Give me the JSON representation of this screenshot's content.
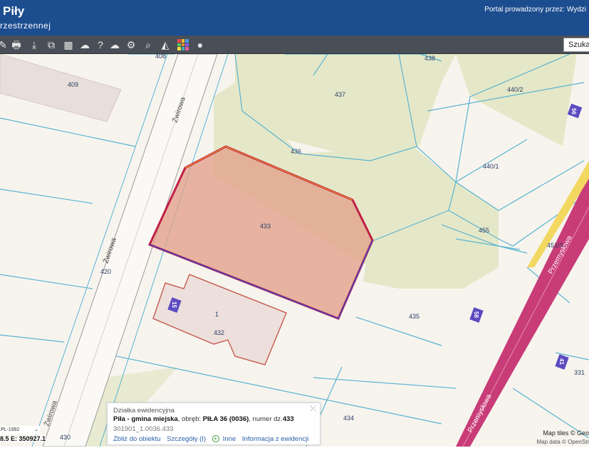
{
  "header": {
    "title": "Piły",
    "subtitle": "rzestrzennej",
    "portal_text": "Portal prowadzony przez: Wydzi"
  },
  "toolbar": {
    "tools": [
      {
        "name": "pan-icon",
        "glyph": "✎"
      },
      {
        "name": "print-icon",
        "glyph": "🖶"
      },
      {
        "name": "download-icon",
        "glyph": "⤓"
      },
      {
        "name": "export-icon",
        "glyph": "⧉"
      },
      {
        "name": "layout-icon",
        "glyph": "▦"
      },
      {
        "name": "comment-icon",
        "glyph": "☁"
      },
      {
        "name": "help-icon",
        "glyph": "?"
      },
      {
        "name": "upload-cloud-icon",
        "glyph": "☁"
      },
      {
        "name": "settings-icon",
        "glyph": "⚙"
      },
      {
        "name": "zoom-search-icon",
        "glyph": "⌕"
      },
      {
        "name": "measure-icon",
        "glyph": "◭"
      },
      {
        "name": "palette-icon",
        "glyph": ""
      },
      {
        "name": "marker-icon",
        "glyph": "●"
      }
    ],
    "search_label": "Szuka"
  },
  "map": {
    "parcels": [
      "409",
      "408",
      "437",
      "438",
      "440/2",
      "436",
      "440/1",
      "433",
      "455",
      "451/3",
      "420",
      "432",
      "435",
      "331",
      "434",
      "430",
      "1"
    ],
    "roads": [
      "Żwirowa",
      "Żwirowa",
      "Żwirowa",
      "Przemysłowa",
      "Przemysłowa"
    ],
    "house_numbers": [
      "56",
      "15",
      "58",
      "41"
    ],
    "colors": {
      "background": "#f7f4ee",
      "green": "#e5e8c8",
      "selected_fill": "#e3a08a",
      "selected_border": "#c02045",
      "building_fill": "#ede0dc",
      "building_border": "#c8625a",
      "parcel_line": "#5ab4d2",
      "road_main": "#c83c78",
      "house_number_bg": "#5c4bc0"
    }
  },
  "popup": {
    "title": "Działka ewidencyjna",
    "gmina": "Piła - gmina miejska",
    "obreb_prefix": ", obręb: ",
    "obreb": "PIŁA 36 (0036)",
    "numer_prefix": ", numer dz.",
    "numer": "433",
    "identifier": "301901_1.0036.433",
    "links": {
      "zoom": "Zbliż do obiektu",
      "details": "Szczegóły (I)",
      "other": "Inne",
      "info": "Informacja z ewidencji"
    }
  },
  "crs": {
    "label": "PL-1992"
  },
  "coords": {
    "text": "8.5  E: 350927.1"
  },
  "attribution": {
    "tiles": "Map tiles © Geo",
    "data": "Map data © OpenStr"
  }
}
